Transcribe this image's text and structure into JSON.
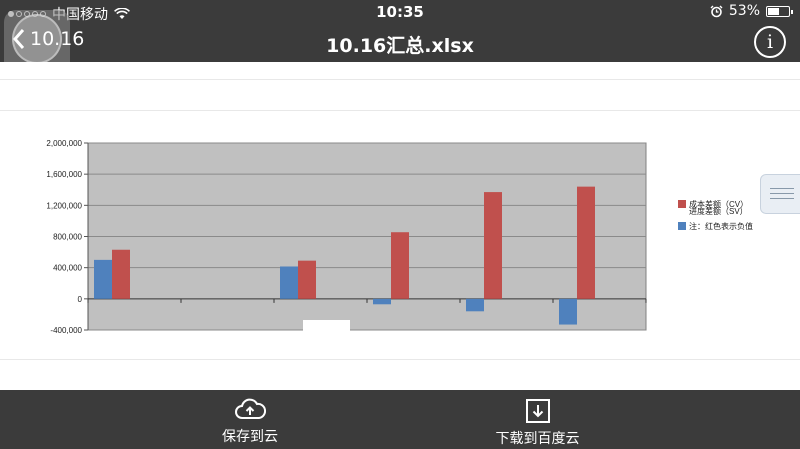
{
  "status": {
    "carrier": "中国移动",
    "time": "10:35",
    "battery": "53%",
    "battery_level": 0.53,
    "signal_strength": 1
  },
  "nav": {
    "back_label": "10.16",
    "title": "10.16汇总.xlsx"
  },
  "chart_data": {
    "type": "bar",
    "ylim": [
      -400000,
      2000000
    ],
    "yticks": [
      "2,000,000",
      "1,600,000",
      "1,200,000",
      "800,000",
      "400,000",
      "0",
      "-400,000"
    ],
    "ytick_values": [
      2000000,
      1600000,
      1200000,
      800000,
      400000,
      0,
      -400000
    ],
    "grid": true,
    "legend_position": "right",
    "colors": {
      "cv": "#c0504d",
      "sv": "#4f81bd",
      "plot_bg": "#c0c0c0"
    },
    "series": [
      {
        "name": "成本差额（CV）",
        "values": [
          630000,
          0,
          490000,
          855000,
          1370000,
          1440000
        ]
      },
      {
        "name": "进度差额（SV）",
        "values": [
          500000,
          0,
          415000,
          -70000,
          -160000,
          -330000
        ]
      }
    ],
    "legend_labels": [
      "成本差额（CV）",
      "进度差额（SV）",
      "注：红色表示负值"
    ]
  },
  "bottom": {
    "save_label": "保存到云",
    "download_label": "下载到百度云"
  }
}
